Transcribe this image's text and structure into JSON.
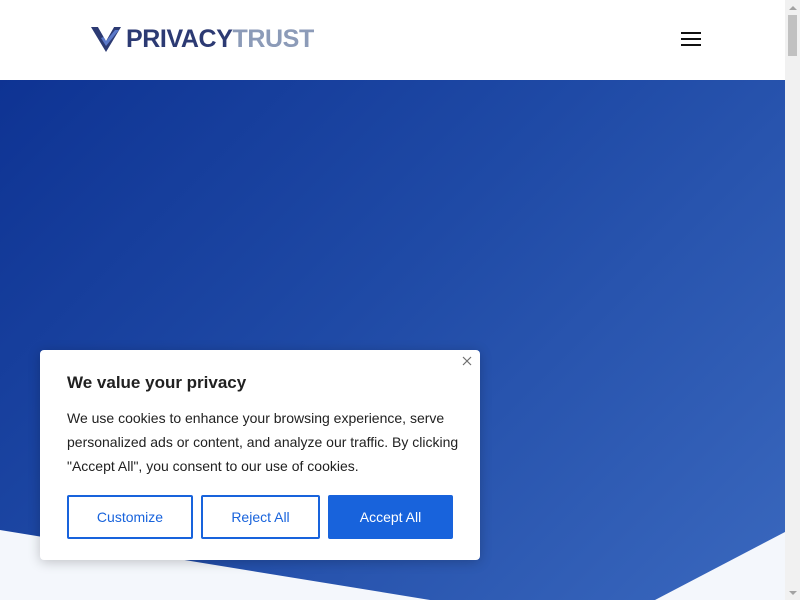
{
  "header": {
    "logo": {
      "text_primary": "PRIVACY",
      "text_secondary": "TRUST",
      "mark_icon": "checkmark-shield-icon"
    },
    "menu_icon": "hamburger-menu-icon"
  },
  "hero": {
    "gradient_colors": [
      "#0e3393",
      "#3a68be"
    ],
    "wedge_color": "#f4f7fc"
  },
  "cookie_banner": {
    "title": "We value your privacy",
    "body": "We use cookies to enhance your browsing experience, serve personalized ads or content, and analyze our traffic. By clicking \"Accept All\", you consent to our use of cookies.",
    "close_icon": "close-icon",
    "buttons": {
      "customize": "Customize",
      "reject": "Reject All",
      "accept": "Accept All"
    },
    "accent_color": "#1863dc"
  },
  "scrollbar": {
    "up_icon": "scroll-up-arrow-icon",
    "down_icon": "scroll-down-arrow-icon"
  }
}
